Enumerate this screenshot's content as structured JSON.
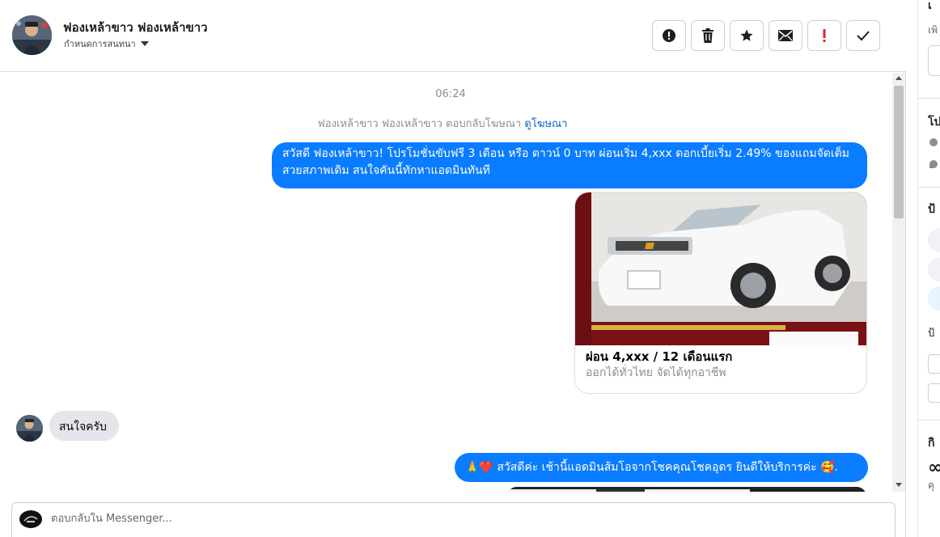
{
  "header": {
    "contact_name": "ฟองเหล้าขาว ฟองเหล้าขาว",
    "assign_label": "กำหนดการสนทนา"
  },
  "actions": [
    {
      "name": "spam",
      "icon": "alert-circle-icon"
    },
    {
      "name": "delete",
      "icon": "trash-icon"
    },
    {
      "name": "star",
      "icon": "star-icon"
    },
    {
      "name": "mark-unread",
      "icon": "envelope-icon"
    },
    {
      "name": "follow-up",
      "icon": "exclamation-icon",
      "color": "#e41e3f"
    },
    {
      "name": "done",
      "icon": "check-icon"
    }
  ],
  "messages": {
    "timestamp": "06:24",
    "ad_reply_prefix": "ฟองเหล้าขาว ฟองเหล้าขาว ตอบกลับโฆษณา",
    "ad_reply_link": "ดูโฆษณา",
    "out_1": "สวัสดี ฟองเหล้าขาว! โปรโมชั่นขับฟรี 3 เดือน หรือ ดาวน์ 0 บาท ผ่อนเริ่ม 4,xxx ดอกเบี้ยเริ่ม 2.49% ของแถมจัดเต็ม สวยสภาพเดิม สนใจคันนี้ทักหาแอดมินทันที",
    "card": {
      "title": "ผ่อน 4,xxx / 12 เดือนแรก",
      "subtitle": "ออกได้ทั่วไทย จัดได้ทุกอาชีพ"
    },
    "in_1": "สนใจครับ",
    "out_2": "🙏❤️ สวัสดีค่ะ เช้านี้แอดมินส้มโอจากโชคคุณโชคอุดร ยินดีให้บริการค่ะ 🥰."
  },
  "composer": {
    "placeholder": "ตอบกลับใน Messenger..."
  },
  "right_panel": {
    "heading_1": "เ",
    "sub_1": "เพิ",
    "heading_2": "โป",
    "heading_3": "ป้",
    "sub_3": "ป้",
    "heading_4": "กิ",
    "sub_4": "คุ"
  },
  "colors": {
    "brand": "#0a7cff",
    "incoming_bubble": "#e4e6eb",
    "link": "#0a66c2",
    "alert": "#e41e3f"
  }
}
